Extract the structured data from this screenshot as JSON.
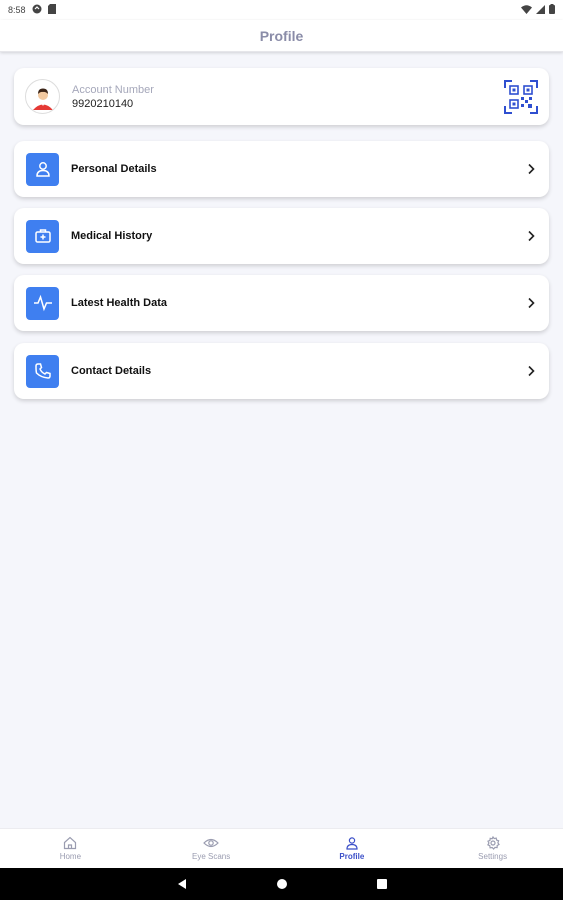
{
  "status_bar": {
    "time": "8:58"
  },
  "header": {
    "title": "Profile"
  },
  "account": {
    "label": "Account Number",
    "number": "9920210140"
  },
  "menu": [
    {
      "label": "Personal Details",
      "icon": "person-icon"
    },
    {
      "label": "Medical History",
      "icon": "medical-kit-icon"
    },
    {
      "label": "Latest Health Data",
      "icon": "pulse-icon"
    },
    {
      "label": "Contact Details",
      "icon": "phone-icon"
    }
  ],
  "bottom_nav": [
    {
      "label": "Home",
      "icon": "home-icon",
      "active": false
    },
    {
      "label": "Eye Scans",
      "icon": "eye-icon",
      "active": false
    },
    {
      "label": "Profile",
      "icon": "person-icon",
      "active": true
    },
    {
      "label": "Settings",
      "icon": "gear-icon",
      "active": false
    }
  ],
  "colors": {
    "accent": "#3f7ff0",
    "active_nav": "#3b4fc8",
    "background": "#f5f6fb"
  }
}
